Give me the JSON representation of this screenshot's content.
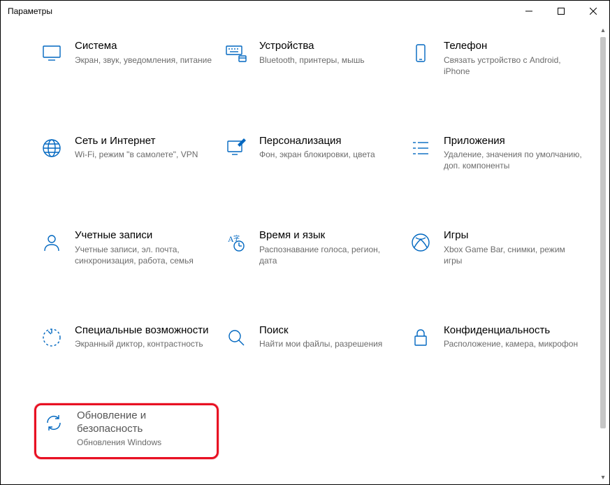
{
  "window": {
    "title": "Параметры"
  },
  "tiles": [
    {
      "id": "system",
      "title": "Система",
      "desc": "Экран, звук, уведомления, питание"
    },
    {
      "id": "devices",
      "title": "Устройства",
      "desc": "Bluetooth, принтеры, мышь"
    },
    {
      "id": "phone",
      "title": "Телефон",
      "desc": "Связать устройство с Android, iPhone"
    },
    {
      "id": "network",
      "title": "Сеть и Интернет",
      "desc": "Wi-Fi, режим \"в самолете\", VPN"
    },
    {
      "id": "personalization",
      "title": "Персонализация",
      "desc": "Фон, экран блокировки, цвета"
    },
    {
      "id": "apps",
      "title": "Приложения",
      "desc": "Удаление, значения по умолчанию, доп. компоненты"
    },
    {
      "id": "accounts",
      "title": "Учетные записи",
      "desc": "Учетные записи, эл. почта, синхронизация, работа, семья"
    },
    {
      "id": "time",
      "title": "Время и язык",
      "desc": "Распознавание голоса, регион, дата"
    },
    {
      "id": "gaming",
      "title": "Игры",
      "desc": "Xbox Game Bar, снимки, режим игры"
    },
    {
      "id": "ease",
      "title": "Специальные возможности",
      "desc": "Экранный диктор, контрастность"
    },
    {
      "id": "search",
      "title": "Поиск",
      "desc": "Найти мои файлы, разрешения"
    },
    {
      "id": "privacy",
      "title": "Конфиденциальность",
      "desc": "Расположение, камера, микрофон"
    },
    {
      "id": "update",
      "title": "Обновление и безопасность",
      "desc": "Обновления Windows"
    }
  ]
}
